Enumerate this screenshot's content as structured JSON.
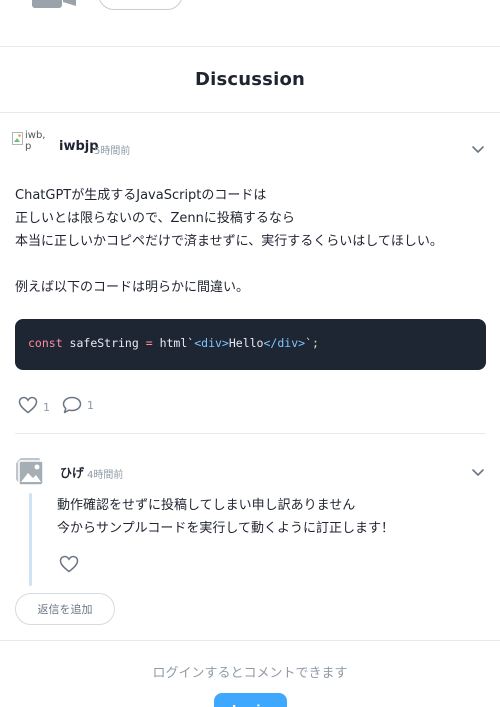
{
  "section": {
    "title": "Discussion"
  },
  "comment": {
    "avatar_alt": "iwb,\np",
    "username": "iwbjp",
    "time": "5時間前",
    "body": [
      "ChatGPTが生成するJavaScriptのコードは",
      "正しいとは限らないので、Zennに投稿するなら",
      "本当に正しいかコピペだけで済ませずに、実行するくらいはしてほしい。",
      "",
      "例えば以下のコードは明らかに間違い。"
    ],
    "code": {
      "keyword": "const",
      "identifier": " safeString ",
      "operator": "=",
      "fn": " html`",
      "open_lt": "<",
      "open_tag": "div",
      "open_gt": ">",
      "text": "Hello",
      "close_lt": "</",
      "close_tag": "div",
      "close_gt": ">",
      "tail": "`;"
    },
    "likes": "1",
    "replies": "1"
  },
  "reply": {
    "username": "ひげ",
    "time": "4時間前",
    "body": [
      "動作確認をせずに投稿してしまい申し訳ありません",
      "今からサンプルコードを実行して動くように訂正します！"
    ]
  },
  "reply_button_label": "返信を追加",
  "login": {
    "prompt": "ログインするとコメントできます",
    "button_label": "Login"
  },
  "colors": {
    "accent": "#3ea8ff",
    "code_bg": "#1e2533",
    "muted": "#8f9aa6"
  }
}
